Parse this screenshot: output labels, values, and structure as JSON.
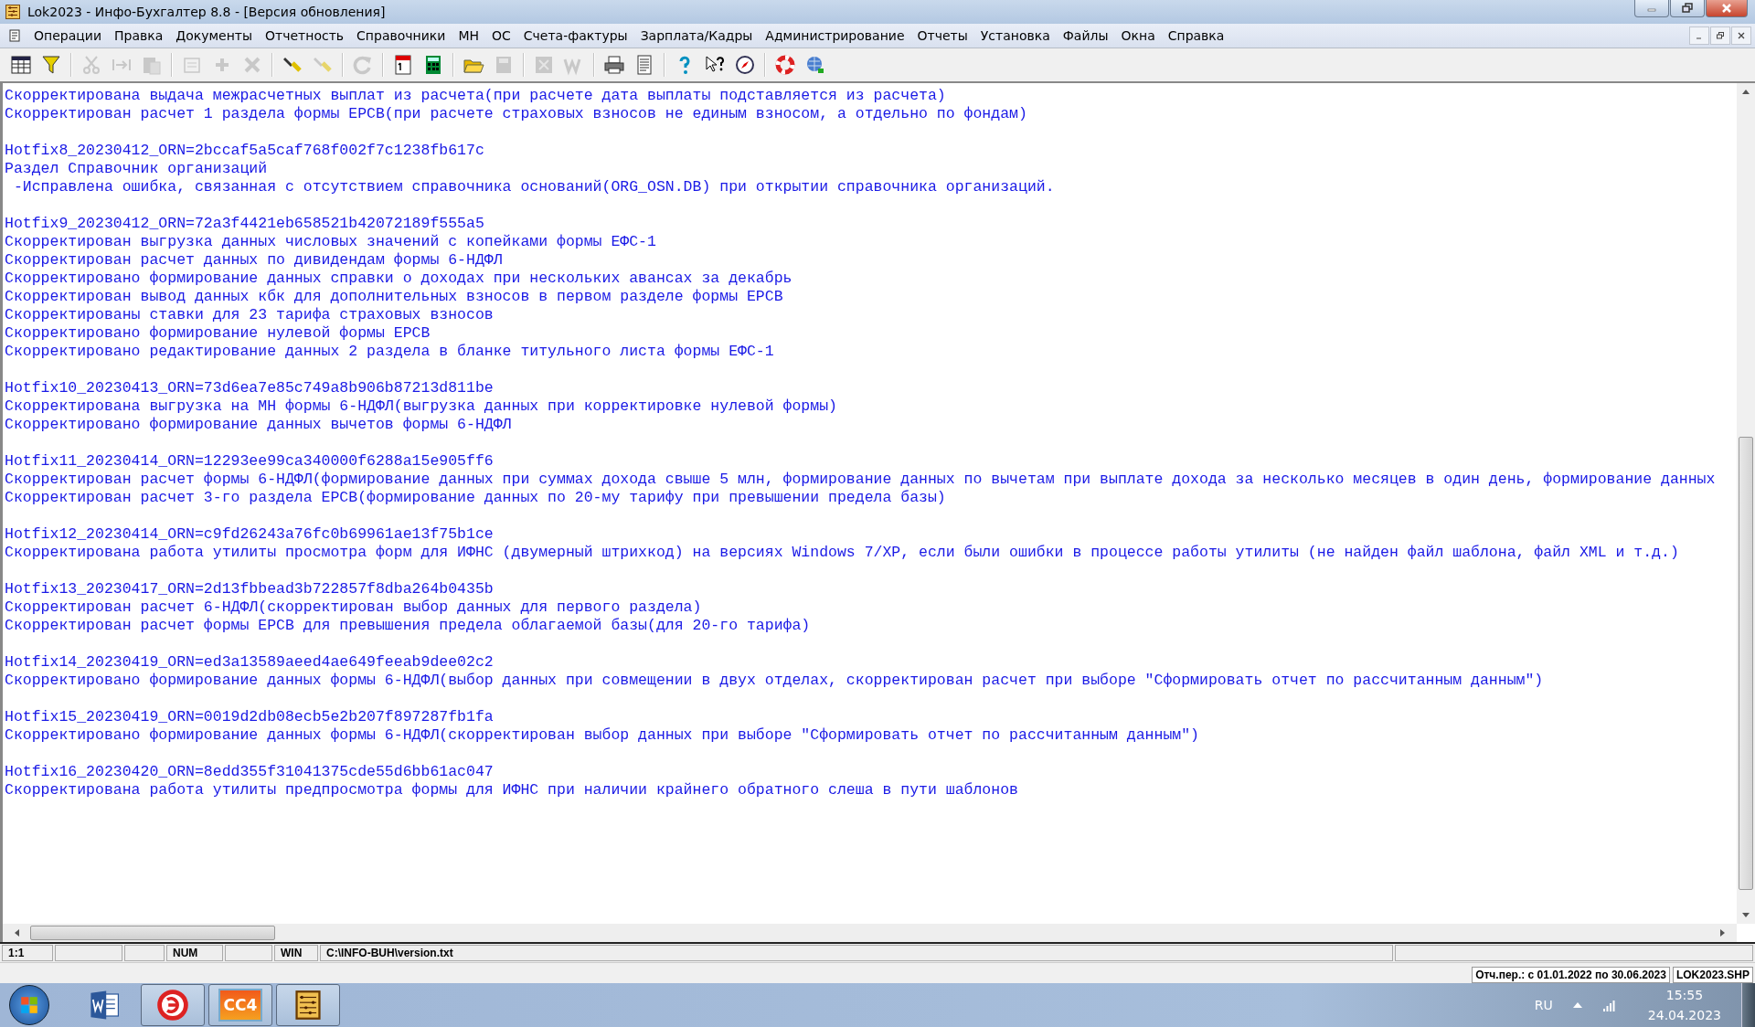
{
  "window": {
    "title": "Lok2023 - Инфо-Бухгалтер 8.8 - [Версия обновления]"
  },
  "menu": [
    "Операции",
    "Правка",
    "Документы",
    "Отчетность",
    "Справочники",
    "МН",
    "ОС",
    "Счета-фактуры",
    "Зарплата/Кадры",
    "Администрирование",
    "Отчеты",
    "Установка",
    "Файлы",
    "Окна",
    "Справка"
  ],
  "toolbar": [
    [
      {
        "disabled": false
      },
      {
        "disabled": false
      }
    ],
    [
      {
        "disabled": true
      },
      {
        "disabled": true
      },
      {
        "disabled": true
      }
    ],
    [
      {
        "disabled": true
      },
      {
        "disabled": true
      },
      {
        "disabled": true
      }
    ],
    [
      {
        "disabled": false
      },
      {
        "disabled": true
      }
    ],
    [
      {
        "disabled": true
      }
    ],
    [
      {
        "disabled": false
      },
      {
        "disabled": false
      }
    ],
    [
      {
        "disabled": false
      },
      {
        "disabled": true
      }
    ],
    [
      {
        "disabled": true
      },
      {
        "disabled": true
      }
    ],
    [
      {
        "disabled": false
      },
      {
        "disabled": false
      }
    ],
    [
      {
        "disabled": false
      },
      {
        "disabled": false
      },
      {
        "disabled": false
      }
    ],
    [
      {
        "disabled": false
      },
      {
        "disabled": false
      }
    ]
  ],
  "document": {
    "blocks": [
      [
        "Скорректирована выдача межрасчетных выплат из расчета(при расчете дата выплаты подставляется из расчета)",
        "Скорректирован расчет 1 раздела формы ЕРСВ(при расчете страховых взносов не единым взносом, а отдельно по фондам)"
      ],
      [
        "Hotfix8_20230412_ORN=2bccaf5a5caf768f002f7c1238fb617c",
        "Раздел Справочник организаций",
        " -Исправлена ошибка, связанная с отсутствием справочника оснований(ORG_OSN.DB) при открытии справочника организаций."
      ],
      [
        "Hotfix9_20230412_ORN=72a3f4421eb658521b42072189f555a5",
        "Скорректирован выгрузка данных числовых значений с копейками формы ЕФС-1",
        "Скорректирован расчет данных по дивидендам формы 6-НДФЛ",
        "Скорректировано формирование данных справки о доходах при нескольких авансах за декабрь",
        "Скорректирован вывод данных кбк для дополнительных взносов в первом разделе формы ЕРСВ",
        "Скорректированы ставки для 23 тарифа страховых взносов",
        "Скорректировано формирование нулевой формы ЕРСВ",
        "Скорректировано редактирование данных 2 раздела в бланке титульного листа формы ЕФС-1"
      ],
      [
        "Hotfix10_20230413_ORN=73d6ea7e85c749a8b906b87213d811be",
        "Скорректирована выгрузка на МН формы 6-НДФЛ(выгрузка данных при корректировке нулевой формы)",
        "Скорректировано формирование данных вычетов формы 6-НДФЛ"
      ],
      [
        "Hotfix11_20230414_ORN=12293ee99ca340000f6288a15e905ff6",
        "Скорректирован расчет формы 6-НДФЛ(формирование данных при суммах дохода свыше 5 млн, формирование данных по вычетам при выплате дохода за несколько месяцев в один день, формирование данных",
        "Скорректирован расчет 3-го раздела ЕРСВ(формирование данных по 20-му тарифу при превышении предела базы)"
      ],
      [
        "Hotfix12_20230414_ORN=c9fd26243a76fc0b69961ae13f75b1ce",
        "Скорректирована работа утилиты просмотра форм для ИФНС (двумерный штрихкод) на версиях Windows 7/XP, если были ошибки в процессе работы утилиты (не найден файл шаблона, файл XML и т.д.)"
      ],
      [
        "Hotfix13_20230417_ORN=2d13fbbead3b722857f8dba264b0435b",
        "Скорректирован расчет 6-НДФЛ(скорректирован выбор данных для первого раздела)",
        "Скорректирован расчет формы ЕРСВ для превышения предела облагаемой базы(для 20-го тарифа)"
      ],
      [
        "Hotfix14_20230419_ORN=ed3a13589aeed4ae649feeab9dee02c2",
        "Скорректировано формирование данных формы 6-НДФЛ(выбор данных при совмещении в двух отделах, скорректирован расчет при выборе \"Сформировать отчет по рассчитанным данным\")"
      ],
      [
        "Hotfix15_20230419_ORN=0019d2db08ecb5e2b207f897287fb1fa",
        "Скорректировано формирование данных формы 6-НДФЛ(скорректирован выбор данных при выборе \"Сформировать отчет по рассчитанным данным\")"
      ],
      [
        "Hotfix16_20230420_ORN=8edd355f31041375cde55d6bb61ac047",
        "Скорректирована работа утилиты предпросмотра формы для ИФНС при наличии крайнего обратного слеша в пути шаблонов"
      ]
    ]
  },
  "status_bar": [
    "1:1",
    "NUM",
    "WIN",
    "C:\\INFO-BUH\\version.txt"
  ],
  "period_bar": [
    "Отч.пер.: с 01.01.2022 по 30.06.2023",
    "LOK2023.SHP"
  ],
  "taskbar": {
    "apps": [
      {
        "kind": "word",
        "running": false
      },
      {
        "kind": "round",
        "running": true
      },
      {
        "kind": "cc",
        "running": true,
        "text": "CC4"
      },
      {
        "kind": "abacus",
        "running": true
      }
    ],
    "language": "RU",
    "time": "15:55",
    "date": "24.04.2023"
  }
}
